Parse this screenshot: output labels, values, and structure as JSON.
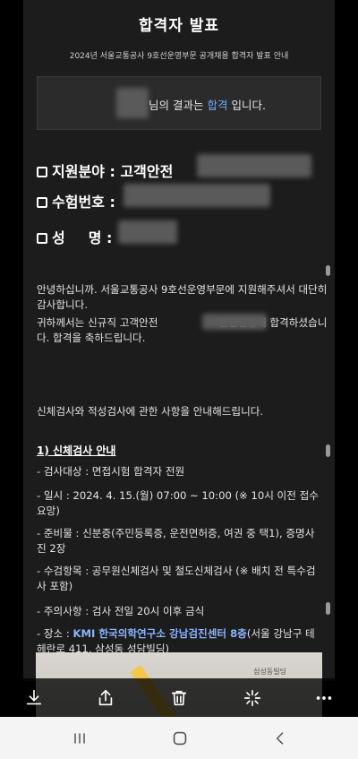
{
  "document": {
    "title": "합격자 발표",
    "subtitle": "2024년 서울교통공사 9호선운영부문 공개채용 합격자 발표 안내",
    "result_prefix": "님의 결과는 ",
    "result_status": "합격",
    "result_suffix": " 입니다.",
    "fields": {
      "field_label": "지원분야 : 고객안전",
      "exam_label": "수험번호 :",
      "name_label_a": "성",
      "name_label_b": "명 :"
    },
    "greeting": "안녕하십니까. 서울교통공사 9호선운영부문에 지원해주셔서 대단히 감사합니다.",
    "congrats_a": "귀하께서는 신규직 고객안전",
    "congrats_b": "면접전형에 합격하셨습니다. 합격을 축하드립니다.",
    "notice": "신체검사와 적성검사에 관한 사항을 안내해드립니다.",
    "section1_title": "1) 신체검사 안내",
    "items": {
      "target": "- 검사대상 : 면접시험 합격자 전원",
      "date": "- 일시 : 2024. 4. 15.(월) 07:00 ~ 10:00 (※ 10시 이전 접수 요망)",
      "prep": "- 준비물 : 신분증(주민등록증, 운전면허증, 여권 중 택1), 증명사진 2장",
      "exam_items": "- 수검항목 : 공무원신체검사 및 철도신체검사 (※ 배치 전 특수검사 포함)",
      "caution": "- 주의사항 : 검사 전일 20시 이후 금식",
      "place_prefix": "- 장소 : ",
      "place_highlight": "KMI 한국의학연구소 강남검진센터 8층",
      "place_suffix": "(서울 강남구 테헤란로 411, 삼성동 성담빌딩)"
    },
    "map_label": "삼성동빌딩"
  },
  "colors": {
    "accent_blue": "#6aa9ff",
    "highlight_blue": "#8ab4ff",
    "doc_background": "#1c1c1c"
  },
  "toolbar": {
    "icons": [
      "download-icon",
      "share-icon",
      "delete-icon",
      "ai-sparkle-icon",
      "more-icon"
    ]
  },
  "navbar": {
    "icons": [
      "recent-apps-icon",
      "home-icon",
      "back-icon"
    ]
  }
}
